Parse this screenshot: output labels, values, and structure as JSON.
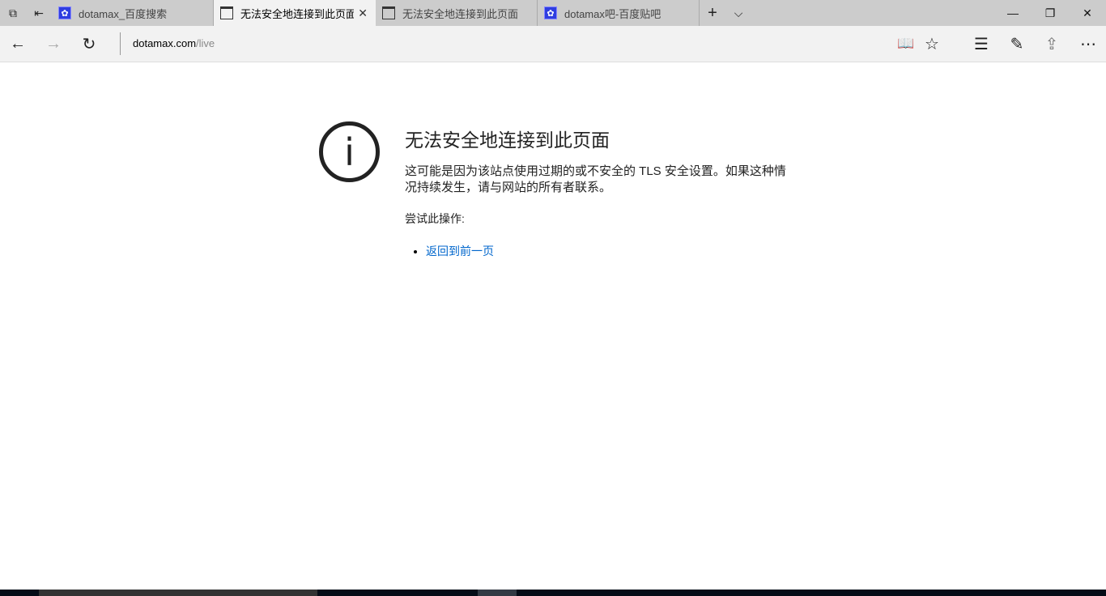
{
  "tabs": [
    {
      "title": "dotamax_百度搜索",
      "icon": "baidu-paw-icon"
    },
    {
      "title": "无法安全地连接到此页面",
      "icon": "page-icon",
      "active": true
    },
    {
      "title": "无法安全地连接到此页面",
      "icon": "page-icon"
    },
    {
      "title": "dotamax吧-百度贴吧",
      "icon": "baidu-paw-icon"
    }
  ],
  "address": {
    "host": "dotamax.com",
    "path": "/live"
  },
  "error": {
    "title": "无法安全地连接到此页面",
    "description": "这可能是因为该站点使用过期的或不安全的 TLS 安全设置。如果这种情况持续发生，请与网站的所有者联系。",
    "try_label": "尝试此操作:",
    "actions": [
      "返回到前一页"
    ]
  }
}
